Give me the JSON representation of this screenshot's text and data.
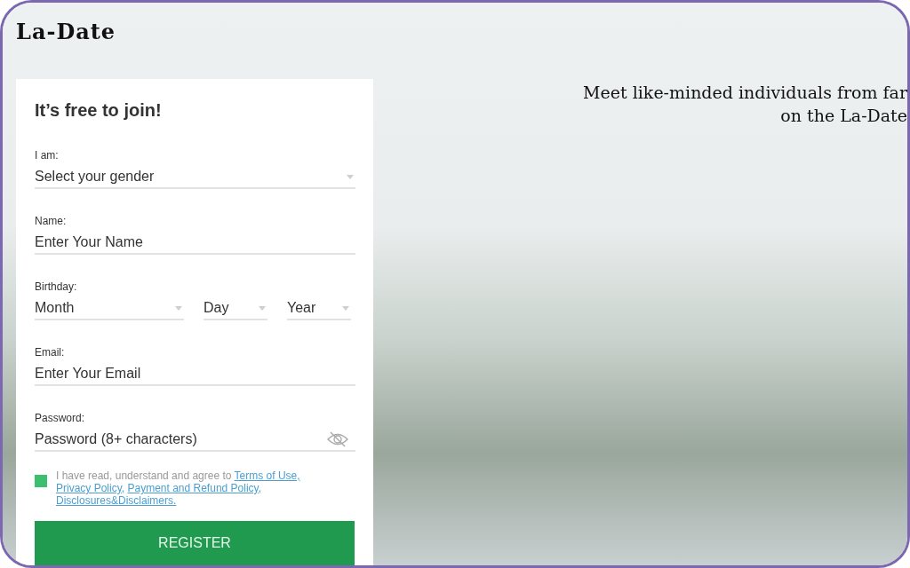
{
  "logo": "La-Date",
  "tagline": [
    "Meet like-minded individuals from far",
    "on the La-Date"
  ],
  "form": {
    "title": "It’s free to join!",
    "fields": [
      {
        "kind": "select",
        "label": "I am:",
        "placeholder": "Select your gender"
      },
      {
        "kind": "text",
        "label": "Name:",
        "placeholder": "Enter Your Name"
      },
      {
        "kind": "date",
        "label": "Birthday:",
        "parts": [
          {
            "placeholder": "Month"
          },
          {
            "placeholder": "Day"
          },
          {
            "placeholder": "Year"
          }
        ]
      },
      {
        "kind": "text",
        "label": "Email:",
        "placeholder": "Enter Your Email"
      },
      {
        "kind": "password",
        "label": "Password:",
        "placeholder": "Password (8+ characters)"
      }
    ],
    "agreement": {
      "checked": true,
      "text": "I have read, understand and agree to",
      "links": [
        "Terms of Use,",
        "Privacy Policy,",
        "Payment and Refund Policy,",
        "Disclosures&Disclaimers."
      ]
    },
    "button": "REGISTER"
  }
}
